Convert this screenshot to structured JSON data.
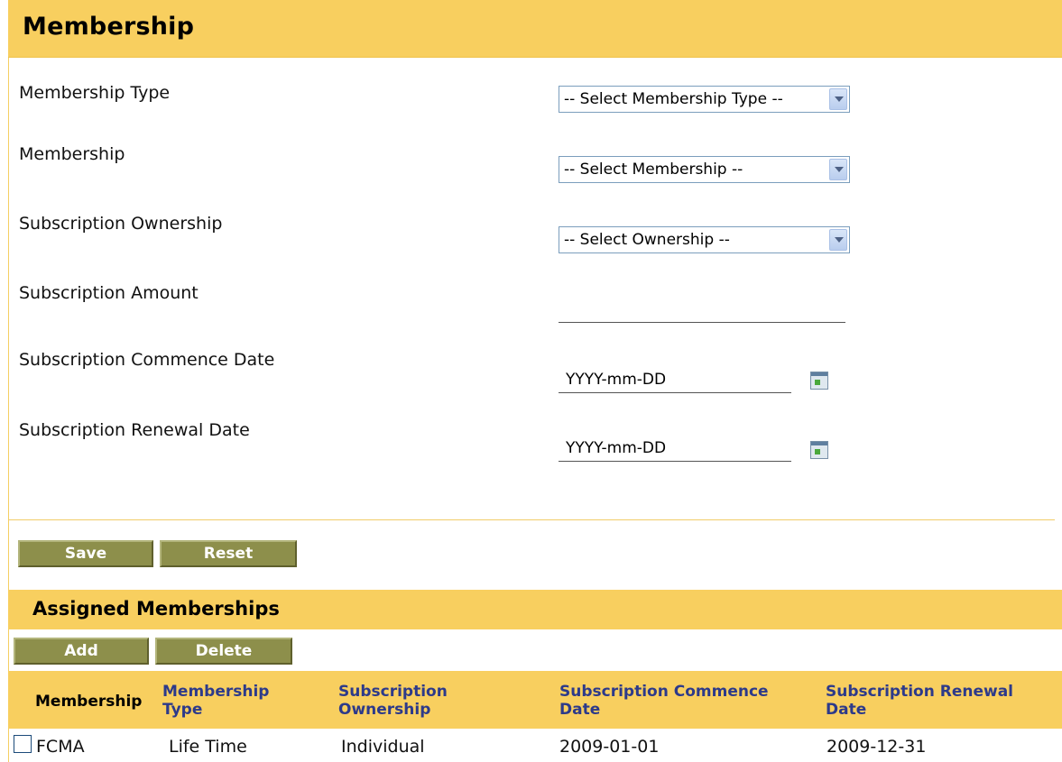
{
  "membership_section": {
    "title": "Membership",
    "fields": {
      "membership_type_label": "Membership Type",
      "membership_type_value": "-- Select Membership Type --",
      "membership_label": "Membership",
      "membership_value": "-- Select Membership --",
      "subscription_ownership_label": "Subscription Ownership",
      "subscription_ownership_value": "-- Select Ownership --",
      "subscription_amount_label": "Subscription Amount",
      "subscription_amount_value": "",
      "commence_date_label": "Subscription Commence Date",
      "commence_date_value": "YYYY-mm-DD",
      "renewal_date_label": "Subscription Renewal Date",
      "renewal_date_value": "YYYY-mm-DD"
    },
    "buttons": {
      "save": "Save",
      "reset": "Reset"
    }
  },
  "assigned_section": {
    "title": "Assigned Memberships",
    "buttons": {
      "add": "Add",
      "delete": "Delete"
    },
    "columns": {
      "membership": "Membership",
      "membership_type": "Membership Type",
      "subscription_ownership": "Subscription Ownership",
      "commence_date": "Subscription Commence Date",
      "renewal_date": "Subscription Renewal Date"
    },
    "rows": [
      {
        "membership": "FCMA",
        "membership_type": "Life Time",
        "subscription_ownership": "Individual",
        "commence_date": "2009-01-01",
        "renewal_date": "2009-12-31"
      }
    ]
  },
  "colors": {
    "header_bg": "#f8cf5f",
    "button_bg": "#8d8f4b",
    "column_header_text": "#2d3a8a"
  }
}
